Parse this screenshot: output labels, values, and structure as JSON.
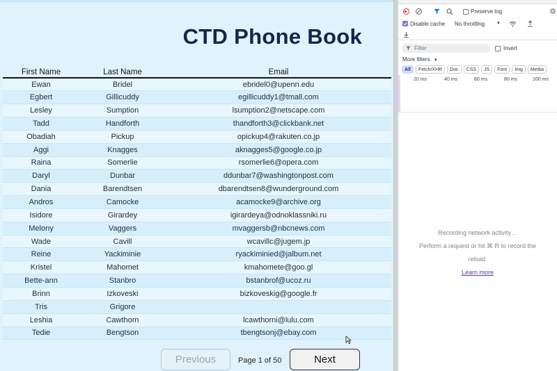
{
  "app": {
    "title": "CTD Phone Book",
    "columns": [
      "First Name",
      "Last Name",
      "Email"
    ],
    "rows": [
      [
        "Ewan",
        "Bridel",
        "ebridel0@upenn.edu"
      ],
      [
        "Egbert",
        "Gillicuddy",
        "egillicuddy1@tmall.com"
      ],
      [
        "Lesley",
        "Sumption",
        "lsumption2@netscape.com"
      ],
      [
        "Tadd",
        "Handforth",
        "thandforth3@clickbank.net"
      ],
      [
        "Obadiah",
        "Pickup",
        "opickup4@rakuten.co.jp"
      ],
      [
        "Aggi",
        "Knagges",
        "aknagges5@google.co.jp"
      ],
      [
        "Raina",
        "Somerlie",
        "rsomerlie6@opera.com"
      ],
      [
        "Daryl",
        "Dunbar",
        "ddunbar7@washingtonpost.com"
      ],
      [
        "Dania",
        "Barendtsen",
        "dbarendtsen8@wunderground.com"
      ],
      [
        "Andros",
        "Camocke",
        "acamocke9@archive.org"
      ],
      [
        "Isidore",
        "Girardey",
        "igirardeya@odnoklassniki.ru"
      ],
      [
        "Melony",
        "Vaggers",
        "mvaggersb@nbcnews.com"
      ],
      [
        "Wade",
        "Cavill",
        "wcavillc@jugem.jp"
      ],
      [
        "Reine",
        "Yackiminie",
        "ryackiminied@jalbum.net"
      ],
      [
        "Kristel",
        "Mahomet",
        "kmahomete@goo.gl"
      ],
      [
        "Bette-ann",
        "Stanbro",
        "bstanbrof@ucoz.ru"
      ],
      [
        "Brinn",
        "Izkoveski",
        "bizkoveskig@google.fr"
      ],
      [
        "Tris",
        "Grigore",
        ""
      ],
      [
        "Leshia",
        "Cawthorn",
        "lcawthorni@lulu.com"
      ],
      [
        "Tedie",
        "Bengtson",
        "tbengtsonj@ebay.com"
      ]
    ],
    "pagination": {
      "previous_label": "Previous",
      "next_label": "Next",
      "indicator": "Page 1 of 50"
    },
    "colors": {
      "title": "#13264a",
      "background": "#e0f3fd"
    }
  },
  "devtools": {
    "toolbar": {
      "record_icon": "record-icon",
      "clear_icon": "clear-icon",
      "filter_icon": "funnel-icon",
      "search_icon": "search-icon",
      "preserve_log_label": "Preserve log",
      "preserve_log_checked": false,
      "settings_icon": "gear-icon",
      "disable_cache_label": "Disable cache",
      "disable_cache_checked": true,
      "throttling_value": "No throttling",
      "wifi_icon": "wifi-icon",
      "upload_icon": "upload-icon",
      "download_icon": "download-icon"
    },
    "filter": {
      "placeholder": "Filter",
      "invert_label": "Invert",
      "more_filters_label": "More filters"
    },
    "type_chips": [
      "All",
      "Fetch/XHR",
      "Doc",
      "CSS",
      "JS",
      "Font",
      "Img",
      "Media"
    ],
    "active_chip": "All",
    "timeline_ticks": [
      "20 ms",
      "40 ms",
      "60 ms",
      "80 ms",
      "100 ms"
    ],
    "empty_state": {
      "line1": "Recording network activity…",
      "line2": "Perform a request or hit ⌘ R to record the",
      "line3": "reload.",
      "link": "Learn more"
    }
  }
}
